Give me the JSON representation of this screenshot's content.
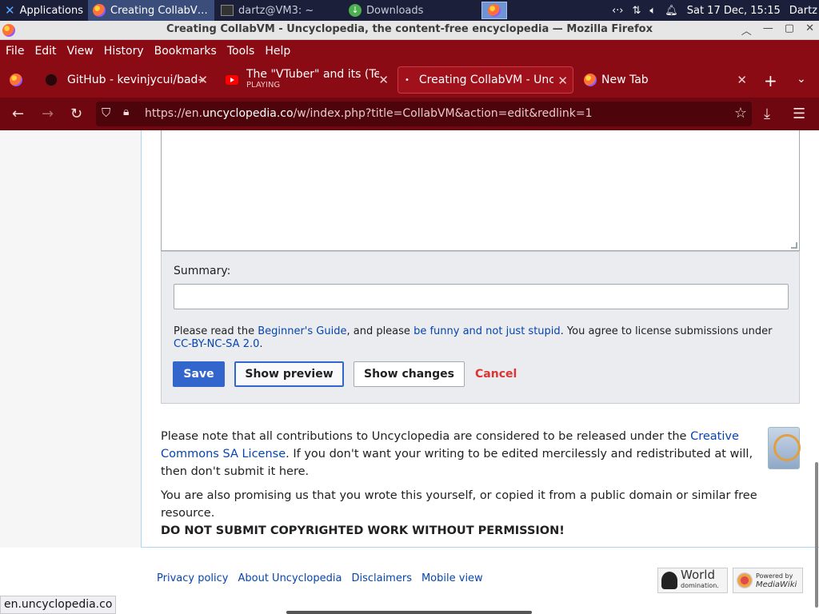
{
  "system_panel": {
    "applications_label": "Applications",
    "tasks": [
      {
        "label": "Creating CollabV…",
        "state": "active"
      },
      {
        "label": "dartz@VM3: ~",
        "state": "inactive"
      },
      {
        "label": "Downloads",
        "state": "inactive"
      }
    ],
    "datetime": "Sat 17 Dec, 15:15",
    "user": "Dartz"
  },
  "window": {
    "title": "Creating CollabVM - Uncyclopedia, the content-free encyclopedia — Mozilla Firefox"
  },
  "menubar": {
    "items": [
      "File",
      "Edit",
      "View",
      "History",
      "Bookmarks",
      "Tools",
      "Help"
    ]
  },
  "tabs": [
    {
      "label": "GitHub - kevinjycui/bad-a",
      "sublabel": ""
    },
    {
      "label": "The \"VTuber\" and its (Tec",
      "sublabel": "PLAYING"
    },
    {
      "label": "Creating CollabVM - Uncy",
      "sublabel": ""
    },
    {
      "label": "New Tab",
      "sublabel": ""
    }
  ],
  "navbar": {
    "url_prefix": "https://en.",
    "url_domain": "uncyclopedia.co",
    "url_suffix": "/w/index.php?title=CollabVM&action=edit&redlink=1"
  },
  "editor": {
    "summary_label": "Summary:",
    "summary_value": "",
    "license": {
      "t1": "Please read the ",
      "link1": "Beginner's Guide",
      "t2": ", and please ",
      "link2": "be funny and not just stupid",
      "t3": ". You agree to license submissions under ",
      "link3": "CC-BY-NC-SA 2.0",
      "t4": "."
    },
    "save_label": "Save",
    "preview_label": "Show preview",
    "changes_label": "Show changes",
    "cancel_label": "Cancel"
  },
  "notes": {
    "copy_t1": "Please note that all contributions to Uncyclopedia are considered to be released under the ",
    "copy_link": "Creative Commons SA License",
    "copy_t2": ". If you don't want your writing to be edited mercilessly and redistributed at will, then don't submit it here.",
    "promise": "You are also promising us that you wrote this yourself, or copied it from a public domain or similar free resource.",
    "warning": "DO NOT SUBMIT COPYRIGHTED WORK WITHOUT PERMISSION!"
  },
  "footer": {
    "links": [
      "Privacy policy",
      "About Uncyclopedia",
      "Disclaimers",
      "Mobile view"
    ],
    "badge_world_title": "World",
    "badge_world_sub": "domination.",
    "badge_mw_top": "Powered by",
    "badge_mw_name": "MediaWiki"
  },
  "status_url": "en.uncyclopedia.co",
  "colors": {
    "firefox_theme": "#8b0b14",
    "link": "#0645ad",
    "save_button": "#3366cc",
    "cancel": "#dd3333"
  }
}
